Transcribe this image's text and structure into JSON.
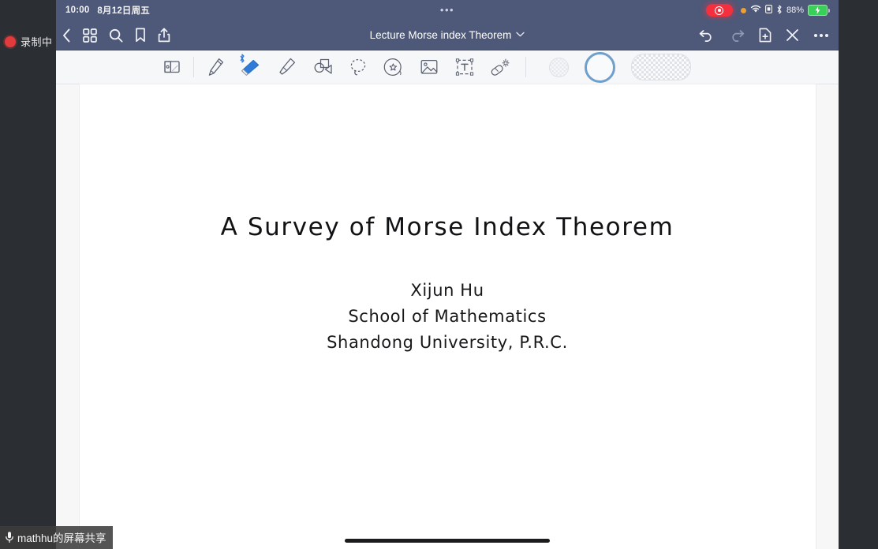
{
  "desktop": {
    "recording_label": "录制中",
    "recording_dot_color": "#e23b3b",
    "background_color": "#2b2e33"
  },
  "share_overlay": {
    "label": "mathhu的屏幕共享",
    "mic_icon": "microphone-icon"
  },
  "status_bar": {
    "time": "10:00",
    "date": "8月12日周五",
    "center_dots": "•••",
    "recording_pill": "screen-record-active",
    "orange_dot": "mic-in-use-indicator",
    "wifi_icon": "wifi-icon",
    "sim_icon": "sim-card-icon",
    "bluetooth_icon": "bluetooth-icon",
    "battery_percent": "88%",
    "battery_state": "charging",
    "background_color": "#4e5878"
  },
  "nav_bar": {
    "title": "Lecture Morse index Theorem",
    "title_chevron": "chevron-down-icon",
    "left_items": [
      {
        "name": "back-button",
        "icon": "chevron-left-icon"
      },
      {
        "name": "page-thumbnails-button",
        "icon": "grid-icon"
      },
      {
        "name": "search-button",
        "icon": "search-icon"
      },
      {
        "name": "bookmark-button",
        "icon": "bookmark-icon"
      },
      {
        "name": "share-button",
        "icon": "share-icon"
      }
    ],
    "right_items": [
      {
        "name": "undo-button",
        "icon": "undo-icon",
        "enabled": true
      },
      {
        "name": "redo-button",
        "icon": "redo-icon",
        "enabled": false
      },
      {
        "name": "add-page-button",
        "icon": "document-plus-icon",
        "enabled": true
      },
      {
        "name": "close-button",
        "icon": "close-x-icon",
        "enabled": true
      },
      {
        "name": "more-button",
        "icon": "ellipsis-icon",
        "enabled": true
      }
    ]
  },
  "toolbar": {
    "background_color": "#f6f7f9",
    "selected_tool": "eraser",
    "bluetooth_badge": "bluetooth-icon",
    "tools": [
      {
        "name": "ruler-page-tool",
        "icon": "page-ruler-icon"
      },
      {
        "name": "pen-tool",
        "icon": "pen-icon"
      },
      {
        "name": "eraser-tool",
        "icon": "eraser-icon",
        "selected": true
      },
      {
        "name": "highlighter-tool",
        "icon": "highlighter-icon"
      },
      {
        "name": "shapes-tool",
        "icon": "shapes-icon"
      },
      {
        "name": "lasso-tool",
        "icon": "lasso-icon"
      },
      {
        "name": "sticker-tool",
        "icon": "sticker-star-icon"
      },
      {
        "name": "image-tool",
        "icon": "image-icon"
      },
      {
        "name": "text-box-tool",
        "icon": "text-box-icon"
      },
      {
        "name": "magic-eraser-tool",
        "icon": "magic-wand-icon"
      }
    ],
    "swatches": [
      {
        "name": "size-swatch-small",
        "style": "checkered-circle",
        "selected": false
      },
      {
        "name": "size-swatch-medium",
        "style": "blue-ring",
        "selected": true,
        "color": "#6f9fca"
      },
      {
        "name": "size-swatch-wide",
        "style": "checkered-pill",
        "selected": false
      }
    ]
  },
  "slide": {
    "title": "A Survey of Morse Index Theorem",
    "lines": [
      "Xijun Hu",
      "School of Mathematics",
      "Shandong University, P.R.C."
    ]
  }
}
